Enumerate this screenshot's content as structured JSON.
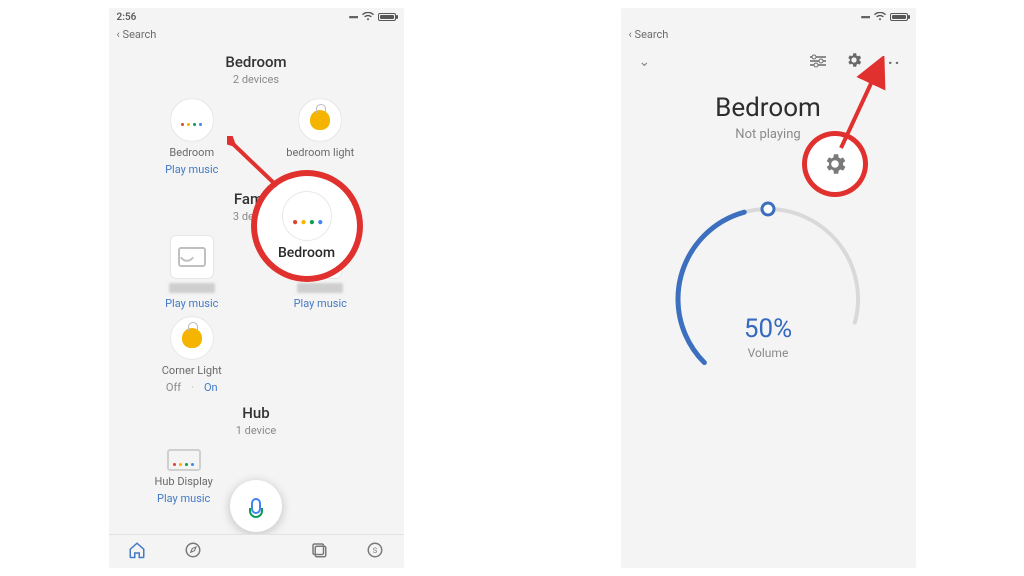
{
  "status": {
    "time": "2:56",
    "back": "Search"
  },
  "left": {
    "rooms": [
      {
        "name": "Bedroom",
        "sub": "2 devices"
      },
      {
        "name": "Family",
        "sub": "3 devices"
      },
      {
        "name": "Hub",
        "sub": "1 device"
      }
    ],
    "devices": {
      "bedroom_speaker": "Bedroom",
      "bedroom_light": "bedroom light",
      "corner_light": "Corner Light",
      "hub_display": "Hub Display"
    },
    "actions": {
      "play_music": "Play music",
      "off": "Off",
      "on": "On",
      "dot": "·"
    },
    "callout_label": "Bedroom"
  },
  "right": {
    "title": "Bedroom",
    "subtitle": "Not playing",
    "volume_pct": "50%",
    "volume_label": "Volume"
  }
}
